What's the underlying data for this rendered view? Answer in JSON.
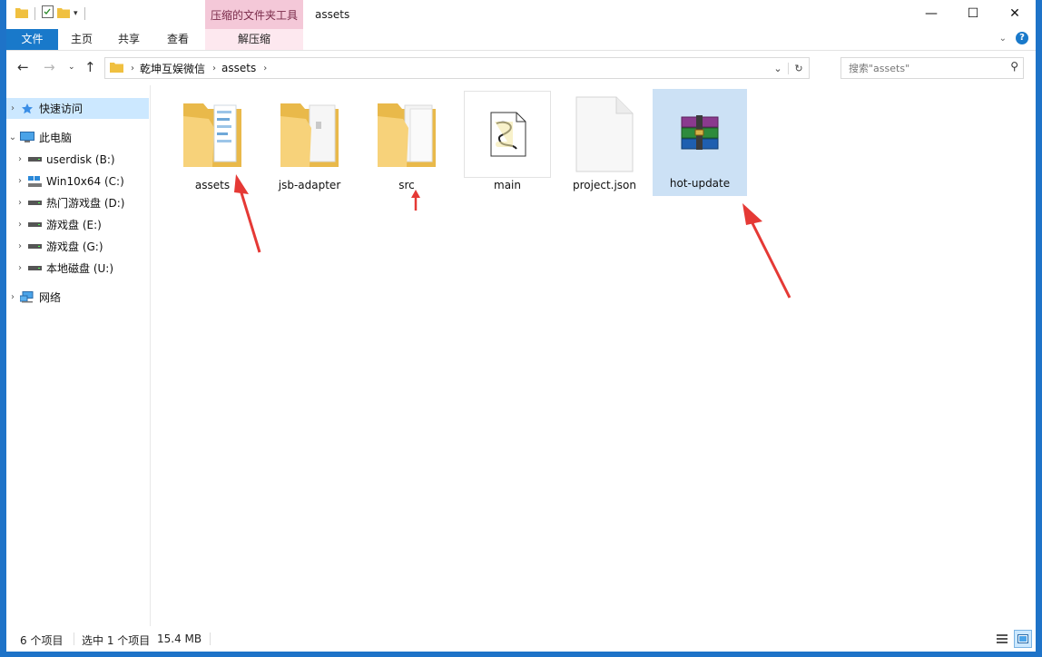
{
  "window": {
    "title": "assets",
    "context_tab_group": "压缩的文件夹工具",
    "controls": {
      "minimize": "—",
      "maximize": "☐",
      "close": "✕"
    }
  },
  "ribbon": {
    "tabs": [
      {
        "label": "文件"
      },
      {
        "label": "主页"
      },
      {
        "label": "共享"
      },
      {
        "label": "查看"
      },
      {
        "label": "解压缩"
      }
    ],
    "help_label": "?"
  },
  "address": {
    "breadcrumbs": [
      "乾坤互娱微信",
      "assets"
    ],
    "search_placeholder": "搜索\"assets\""
  },
  "nav": {
    "items": [
      {
        "label": "快速访问",
        "icon": "star-icon"
      },
      {
        "label": "此电脑",
        "icon": "computer-icon"
      },
      {
        "label": "userdisk (B:)",
        "icon": "drive-icon"
      },
      {
        "label": "Win10x64 (C:)",
        "icon": "windows-drive-icon"
      },
      {
        "label": "热门游戏盘 (D:)",
        "icon": "drive-icon"
      },
      {
        "label": "游戏盘 (E:)",
        "icon": "drive-icon"
      },
      {
        "label": "游戏盘 (G:)",
        "icon": "drive-icon"
      },
      {
        "label": "本地磁盘 (U:)",
        "icon": "drive-icon"
      },
      {
        "label": "网络",
        "icon": "network-icon"
      }
    ]
  },
  "files": [
    {
      "name": "assets",
      "type": "folder",
      "icon": "folder-with-docs-icon"
    },
    {
      "name": "jsb-adapter",
      "type": "folder",
      "icon": "folder-icon"
    },
    {
      "name": "src",
      "type": "folder",
      "icon": "folder-icon"
    },
    {
      "name": "main",
      "type": "script",
      "icon": "script-file-icon"
    },
    {
      "name": "project.json",
      "type": "file",
      "icon": "blank-file-icon"
    },
    {
      "name": "hot-update",
      "type": "archive",
      "icon": "winrar-archive-icon",
      "selected": true
    }
  ],
  "status": {
    "item_count": "6 个项目",
    "selected_count": "选中 1 个项目",
    "selected_size": "15.4 MB"
  },
  "colors": {
    "accent": "#1979ca",
    "context_tab": "#f4c8d8",
    "selection": "#cce8ff",
    "annotation_arrow": "#e53935",
    "desktop": "#1e73c8"
  }
}
